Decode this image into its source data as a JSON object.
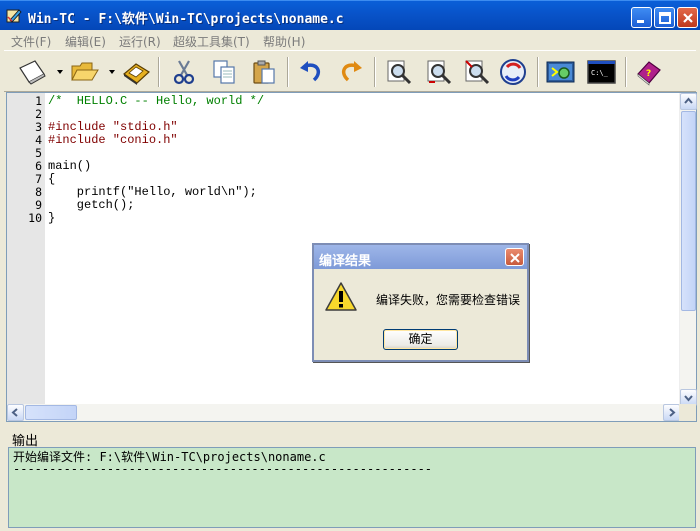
{
  "window": {
    "title": "Win-TC - F:\\软件\\Win-TC\\projects\\noname.c"
  },
  "menu": [
    {
      "label": "文件(F)"
    },
    {
      "label": "编辑(E)"
    },
    {
      "label": "运行(R)"
    },
    {
      "label": "超级工具集(T)"
    },
    {
      "label": "帮助(H)"
    }
  ],
  "toolbar": {
    "buttons": [
      {
        "name": "new-file",
        "icon": "new-page-icon"
      },
      {
        "name": "open-file",
        "icon": "folder-icon"
      },
      {
        "name": "save-file",
        "icon": "disk-icon"
      },
      {
        "name": "cut",
        "icon": "scissors-icon"
      },
      {
        "name": "copy",
        "icon": "copy-icon"
      },
      {
        "name": "paste",
        "icon": "paste-icon"
      },
      {
        "name": "undo",
        "icon": "undo-icon"
      },
      {
        "name": "redo",
        "icon": "redo-icon"
      },
      {
        "name": "find",
        "icon": "find-icon"
      },
      {
        "name": "find-next",
        "icon": "find-next-icon"
      },
      {
        "name": "replace",
        "icon": "replace-icon"
      },
      {
        "name": "refresh",
        "icon": "refresh-icon"
      },
      {
        "name": "compile",
        "icon": "compile-icon"
      },
      {
        "name": "console",
        "icon": "console-icon"
      },
      {
        "name": "help-book",
        "icon": "help-book-icon"
      }
    ]
  },
  "editor": {
    "lines": [
      {
        "no": "1",
        "text": "/*  HELLO.C -- Hello, world */",
        "kind": "comment"
      },
      {
        "no": "2",
        "text": "",
        "kind": "plain"
      },
      {
        "no": "3",
        "text": "#include \"stdio.h\"",
        "kind": "pre"
      },
      {
        "no": "4",
        "text": "#include \"conio.h\"",
        "kind": "pre"
      },
      {
        "no": "5",
        "text": "",
        "kind": "plain"
      },
      {
        "no": "6",
        "text": "main()",
        "kind": "plain"
      },
      {
        "no": "7",
        "text": "{",
        "kind": "plain"
      },
      {
        "no": "8",
        "text": "    printf(\"Hello, world\\n\");",
        "kind": "plain"
      },
      {
        "no": "9",
        "text": "    getch();",
        "kind": "plain"
      },
      {
        "no": "10",
        "text": "}",
        "kind": "plain"
      }
    ]
  },
  "output": {
    "label": "输出",
    "lines": [
      "开始编译文件: F:\\软件\\Win-TC\\projects\\noname.c",
      "----------------------------------------------------------"
    ]
  },
  "dialog": {
    "title": "编译结果",
    "message": "编译失败，您需要检查错误",
    "ok_label": "确定",
    "icon": "warning-icon"
  },
  "colors": {
    "titlebar": "#0853c9",
    "output_bg": "#c8e7c8",
    "comment": "#008000",
    "preprocessor": "#800000"
  }
}
